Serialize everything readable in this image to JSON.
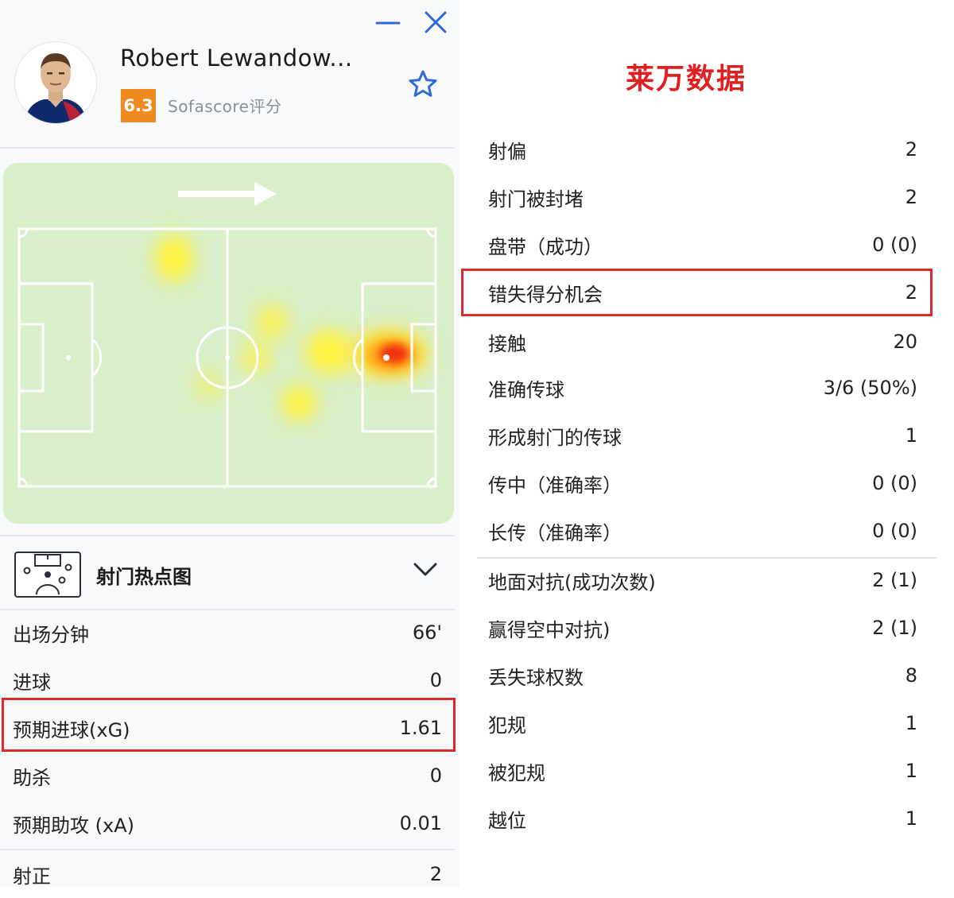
{
  "player": {
    "name": "Robert Lewandow...",
    "rating": "6.3",
    "rating_source": "Sofascore评分"
  },
  "icons": {
    "minimize": "minimize-icon",
    "close": "close-icon",
    "favorite": "star-icon",
    "shotmap": "football-pitch-icon",
    "expand": "chevron-down-icon"
  },
  "colors": {
    "accent_blue": "#2f6bd6",
    "rating_orange": "#f0891e",
    "highlight_red": "#e02a2a",
    "pitch_green": "#d9efc9"
  },
  "shotmap": {
    "label": "射门热点图"
  },
  "left_stats": [
    {
      "label": "出场分钟",
      "value": "66'"
    },
    {
      "label": "进球",
      "value": "0"
    },
    {
      "label": "预期进球(xG)",
      "value": "1.61",
      "highlighted": true
    },
    {
      "label": "助杀",
      "value": "0"
    },
    {
      "label": "预期助攻 (xA)",
      "value": "0.01"
    },
    {
      "label": "射正",
      "value": "2"
    }
  ],
  "right_panel": {
    "title": "莱万数据",
    "stats": [
      {
        "label": "射偏",
        "value": "2"
      },
      {
        "label": "射门被封堵",
        "value": "2"
      },
      {
        "label": "盘带（成功）",
        "value": "0 (0)"
      },
      {
        "label": "错失得分机会",
        "value": "2",
        "highlighted": true
      },
      {
        "label": "接触",
        "value": "20"
      },
      {
        "label": "准确传球",
        "value": "3/6 (50%)"
      },
      {
        "label": "形成射门的传球",
        "value": "1"
      },
      {
        "label": "传中（准确率）",
        "value": "0 (0)"
      },
      {
        "label": "长传（准确率）",
        "value": "0 (0)"
      },
      {
        "label": "地面对抗(成功次数)",
        "value": "2 (1)"
      },
      {
        "label": "赢得空中对抗)",
        "value": "2 (1)"
      },
      {
        "label": "丢失球权数",
        "value": "8"
      },
      {
        "label": "犯规",
        "value": "1"
      },
      {
        "label": "被犯规",
        "value": "1"
      },
      {
        "label": "越位",
        "value": "1"
      }
    ]
  }
}
